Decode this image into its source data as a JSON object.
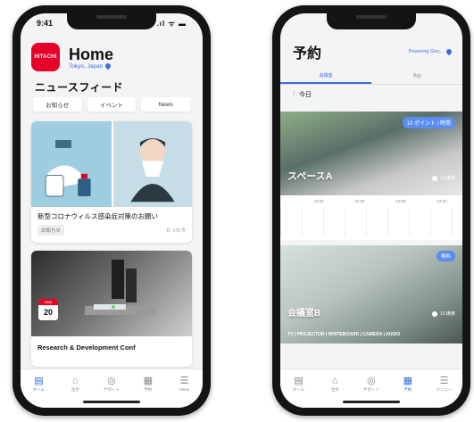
{
  "left": {
    "status": {
      "time": "9:41",
      "icons": ".ıl ᯤ ▬"
    },
    "logo_text": "HITACHI",
    "title": "Home",
    "location": "Tokyo, Japan",
    "feed_title": "ニュースフィード",
    "tabs": [
      "お知らせ",
      "イベント",
      "News"
    ],
    "card1": {
      "title": "新型コロナウィルス感染症対策のお願い",
      "chip": "お知らせ",
      "date": "たった今"
    },
    "card2": {
      "cal_month": "Sep",
      "cal_day": "20",
      "title": "Research & Development Conf"
    },
    "nav": [
      {
        "icon": "home-icon",
        "label": "ホーム"
      },
      {
        "icon": "bag-icon",
        "label": "注文"
      },
      {
        "icon": "support-icon",
        "label": "サポート"
      },
      {
        "icon": "calendar-icon",
        "label": "予約"
      },
      {
        "icon": "menu-icon",
        "label": "Menu"
      }
    ]
  },
  "right": {
    "title": "予約",
    "location": "Powering Goo...",
    "tabs": [
      "会議室",
      "予約"
    ],
    "filter_label": "今日",
    "space": {
      "points": "10 ポイント / 時間",
      "name": "スペースA",
      "capacity": "10 席席"
    },
    "timeline": [
      "10:00",
      "11:00",
      "12:00",
      "13:00"
    ],
    "room": {
      "badge": "無料",
      "name": "会議室B",
      "capacity": "10 席席",
      "amenities": "TV | PROJECTOR | WHITEBOARD | CAMERA | AUDIO"
    },
    "nav": [
      {
        "icon": "home-icon",
        "label": "ホーム"
      },
      {
        "icon": "bag-icon",
        "label": "注文"
      },
      {
        "icon": "support-icon",
        "label": "サポート"
      },
      {
        "icon": "calendar-icon",
        "label": "予約"
      },
      {
        "icon": "menu-icon",
        "label": "メニュー"
      }
    ]
  },
  "colors": {
    "accent": "#3b6ee0",
    "brand_red": "#e60027",
    "badge_blue": "#5b8cf0"
  }
}
